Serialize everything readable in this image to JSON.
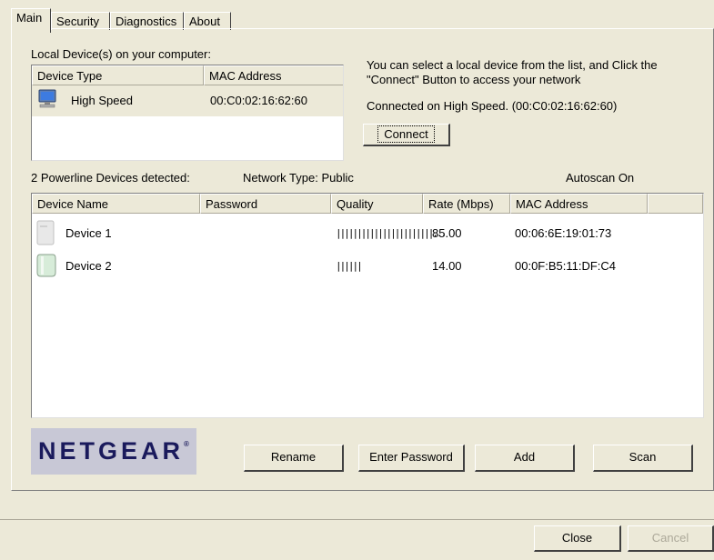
{
  "tabs": [
    {
      "label": "Main"
    },
    {
      "label": "Security"
    },
    {
      "label": "Diagnostics"
    },
    {
      "label": "About"
    }
  ],
  "local": {
    "group_label": "Local Device(s) on your computer:",
    "columns": [
      "Device Type",
      "MAC Address"
    ],
    "rows": [
      {
        "icon": "computer-monitor-icon",
        "type": "High Speed",
        "mac": "00:C0:02:16:62:60"
      }
    ]
  },
  "info": {
    "instructions": "You can select a local device from the list, and Click the \"Connect\" Button to access your network",
    "connected": "Connected on  High Speed. (00:C0:02:16:62:60)",
    "connect_button": "Connect"
  },
  "status": {
    "detected": "2 Powerline Devices detected:",
    "network_type": "Network Type: Public",
    "autoscan": "Autoscan On"
  },
  "devices": {
    "columns": [
      "Device Name",
      "Password",
      "Quality",
      "Rate (Mbps)",
      "MAC Address"
    ],
    "rows": [
      {
        "icon": "powerline-adapter-icon",
        "name": "Device 1",
        "password": "",
        "quality": "|||||||||||||||||||||||...",
        "rate": "85.00",
        "mac": "00:06:6E:19:01:73"
      },
      {
        "icon": "powerline-adapter-icon",
        "name": "Device 2",
        "password": "",
        "quality": "||||||",
        "rate": "14.00",
        "mac": "00:0F:B5:11:DF:C4"
      }
    ]
  },
  "brand": {
    "logo": "NETGEAR",
    "mark": "®"
  },
  "actions": {
    "rename": "Rename",
    "enter_password": "Enter Password",
    "add": "Add",
    "scan": "Scan"
  },
  "footer": {
    "close": "Close",
    "cancel": "Cancel"
  },
  "colors": {
    "dialog_bg": "#ece9d8",
    "brand_logo_bg": "#c8c8d6",
    "brand_logo_text": "#1a1a5c"
  }
}
